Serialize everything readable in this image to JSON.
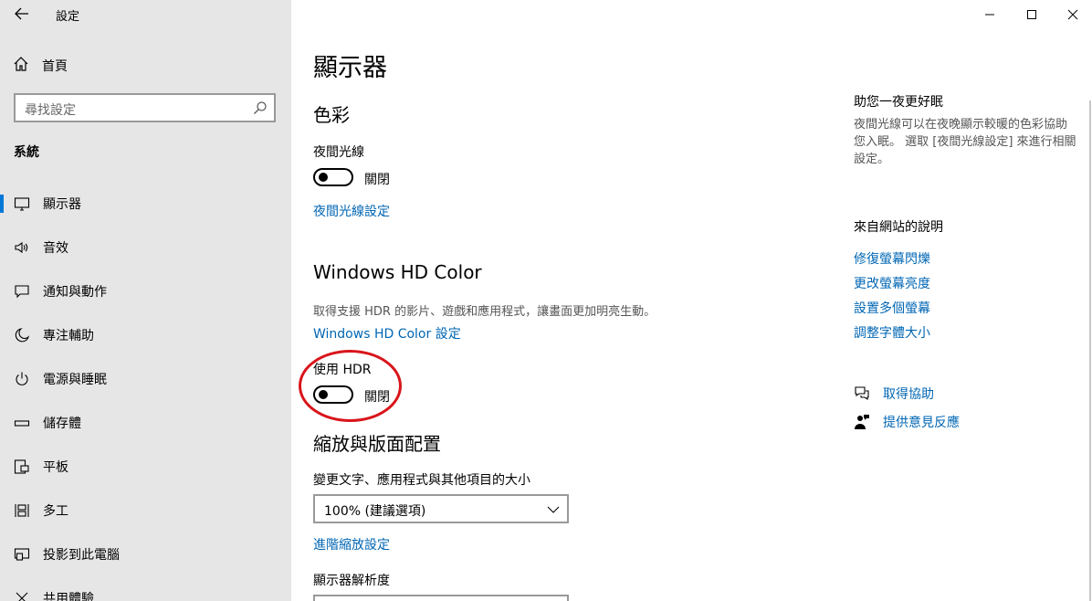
{
  "window": {
    "title": "設定"
  },
  "sidebar": {
    "home_label": "首頁",
    "search_placeholder": "尋找設定",
    "section_label": "系統",
    "items": [
      {
        "label": "顯示器",
        "icon": "monitor-icon",
        "active": true
      },
      {
        "label": "音效",
        "icon": "speaker-icon"
      },
      {
        "label": "通知與動作",
        "icon": "notification-icon"
      },
      {
        "label": "專注輔助",
        "icon": "moon-icon"
      },
      {
        "label": "電源與睡眠",
        "icon": "power-icon"
      },
      {
        "label": "儲存體",
        "icon": "storage-icon"
      },
      {
        "label": "平板",
        "icon": "tablet-icon"
      },
      {
        "label": "多工",
        "icon": "multitasking-icon"
      },
      {
        "label": "投影到此電腦",
        "icon": "project-icon"
      },
      {
        "label": "共用體驗",
        "icon": "shared-icon"
      }
    ]
  },
  "main": {
    "title": "顯示器",
    "color_heading": "色彩",
    "night_light_label": "夜間光線",
    "night_light_state": "關閉",
    "night_light_link": "夜間光線設定",
    "hd_color_heading": "Windows HD Color",
    "hd_color_desc": "取得支援 HDR 的影片、遊戲和應用程式，讓畫面更加明亮生動。",
    "hd_color_link": "Windows HD Color 設定",
    "hdr_label": "使用 HDR",
    "hdr_state": "關閉",
    "scale_heading": "縮放與版面配置",
    "scale_label": "變更文字、應用程式與其他項目的大小",
    "scale_value": "100% (建議選項)",
    "advanced_scale_link": "進階縮放設定",
    "resolution_label": "顯示器解析度"
  },
  "side": {
    "tip_heading": "助您一夜更好眠",
    "tip_text": "夜間光線可以在夜晚顯示較暖的色彩協助您入眠。 選取 [夜間光線設定] 來進行相關設定。",
    "help_heading": "來自網站的說明",
    "links": [
      "修復螢幕閃爍",
      "更改螢幕亮度",
      "設置多個螢幕",
      "調整字體大小"
    ],
    "get_help": "取得協助",
    "feedback": "提供意見反應"
  },
  "colors": {
    "accent": "#0078d7",
    "link": "#0066b4",
    "sidebar_bg": "#e6e6e6",
    "annotation": "#d9151b"
  }
}
